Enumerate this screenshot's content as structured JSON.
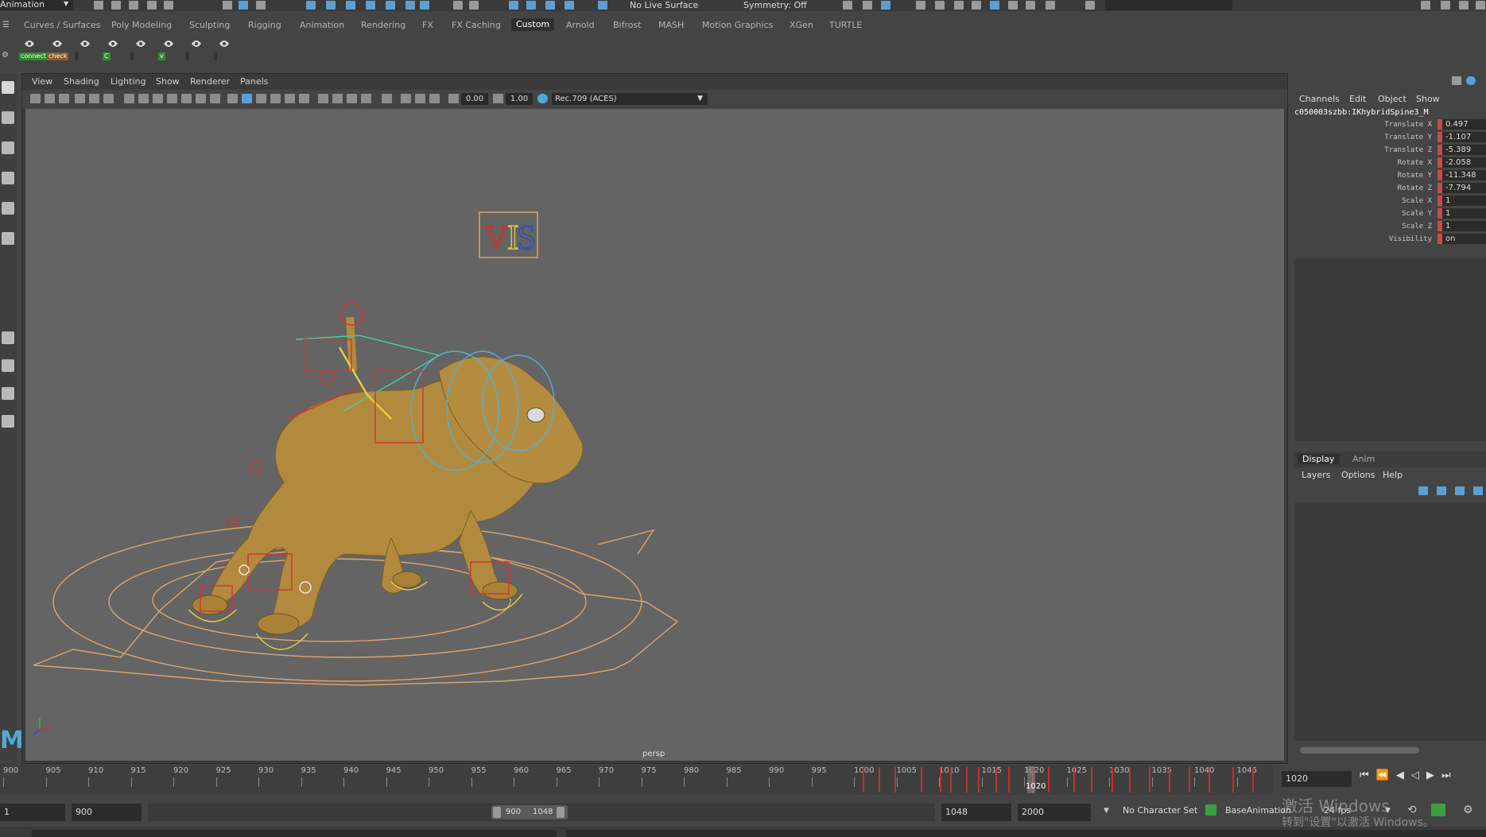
{
  "topbar": {
    "mode": "Animation",
    "live_surface": "No Live Surface",
    "symmetry": "Symmetry: Off"
  },
  "shelf": {
    "tabs": [
      "Curves / Surfaces",
      "Poly Modeling",
      "Sculpting",
      "Rigging",
      "Animation",
      "Rendering",
      "FX",
      "FX Caching",
      "Custom",
      "Arnold",
      "Bifrost",
      "MASH",
      "Motion Graphics",
      "XGen",
      "TURTLE"
    ],
    "active_tab": "Custom",
    "buttons": [
      {
        "label": "connect",
        "color": "#2e8b2e"
      },
      {
        "label": "check",
        "color": "#8a5a2a"
      },
      {
        "label": "",
        "color": "#333"
      },
      {
        "label": "C",
        "color": "#2e8b2e"
      },
      {
        "label": "",
        "color": "#333"
      },
      {
        "label": "v",
        "color": "#2e8b2e"
      },
      {
        "label": "",
        "color": "#333"
      },
      {
        "label": "",
        "color": "#333"
      }
    ]
  },
  "viewport": {
    "menus": [
      "View",
      "Shading",
      "Lighting",
      "Show",
      "Renderer",
      "Panels"
    ],
    "exposure": "0.00",
    "gamma": "1.00",
    "color_space": "Rec.709 (ACES)",
    "camera_label": "persp"
  },
  "channels": {
    "menus": [
      "Channels",
      "Edit",
      "Object",
      "Show"
    ],
    "object_name": "c050003szbb:IKhybridSpine3_M",
    "attributes": [
      {
        "label": "Translate X",
        "value": "0.497"
      },
      {
        "label": "Translate Y",
        "value": "-1.107"
      },
      {
        "label": "Translate Z",
        "value": "-5.389"
      },
      {
        "label": "Rotate X",
        "value": "-2.058"
      },
      {
        "label": "Rotate Y",
        "value": "-11.348"
      },
      {
        "label": "Rotate Z",
        "value": "-7.794"
      },
      {
        "label": "Scale X",
        "value": "1"
      },
      {
        "label": "Scale Y",
        "value": "1"
      },
      {
        "label": "Scale Z",
        "value": "1"
      },
      {
        "label": "Visibility",
        "value": "on"
      }
    ]
  },
  "layers": {
    "tabs": [
      "Display",
      "Anim"
    ],
    "active_tab": "Display",
    "menus": [
      "Layers",
      "Options",
      "Help"
    ]
  },
  "timeline": {
    "tick_labels": [
      "900",
      "905",
      "910",
      "915",
      "920",
      "925",
      "930",
      "935",
      "940",
      "945",
      "950",
      "955",
      "960",
      "965",
      "970",
      "975",
      "980",
      "985",
      "990",
      "995",
      "1000",
      "1005",
      "1010",
      "1015",
      "1020",
      "1025",
      "1030",
      "1035",
      "1040",
      "1045"
    ],
    "current_frame": "1020",
    "current_frame_field": "1020"
  },
  "range": {
    "start_field": "1",
    "playback_start": "900",
    "slider_start": "900",
    "slider_end": "1048",
    "playback_end": "1048",
    "end_field": "2000",
    "character_set": "No Character Set",
    "anim_layer": "BaseAnimation",
    "fps": "24 fps"
  },
  "watermark": {
    "line1": "激活 Windows",
    "line2": "转到\"设置\"以激活 Windows。"
  }
}
